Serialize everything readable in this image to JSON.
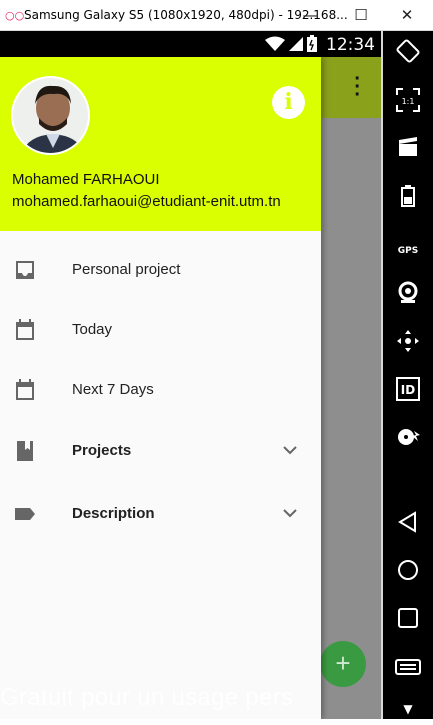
{
  "window": {
    "logo_glyph": "○○",
    "title": "Samsung Galaxy S5 (1080x1920, 480dpi) - 192.168...",
    "minimize": "—",
    "maximize": "☐",
    "close": "✕"
  },
  "statusbar": {
    "time": "12:34",
    "icons": [
      "wifi-icon",
      "signal-icon",
      "battery-icon"
    ]
  },
  "drawer": {
    "user_name": "Mohamed FARHAOUI",
    "user_email": "mohamed.farhaoui@etudiant-enit.utm.tn",
    "info_glyph": "i",
    "items": [
      {
        "label": "Personal project",
        "icon": "inbox-icon",
        "bold": false
      },
      {
        "label": "Today",
        "icon": "calendar-icon",
        "bold": false
      },
      {
        "label": "Next 7 Days",
        "icon": "calendar-icon",
        "bold": false
      },
      {
        "label": "Projects",
        "icon": "book-icon",
        "bold": true,
        "expandable": true
      },
      {
        "label": "Description",
        "icon": "label-icon",
        "bold": true,
        "expandable": true
      }
    ]
  },
  "fab": {
    "glyph": "+"
  },
  "watermark": "Gratuit pour un usage pers",
  "sidebar": {
    "buttons": [
      "rotate-icon",
      "scale-icon",
      "screencast-icon",
      "battery-icon",
      "gps-icon",
      "camera-icon",
      "dpad-icon",
      "id-icon",
      "disk-icon",
      "back-icon",
      "home-icon",
      "recent-apps-icon",
      "menu-icon"
    ],
    "gps_label": "GPS",
    "id_label": "ID",
    "scale_label": "1:1"
  },
  "colors": {
    "header": "#d9ff00",
    "toolbar": "#8aa11b",
    "fab": "#3a9a41",
    "drawer_bg": "#fafafa"
  }
}
